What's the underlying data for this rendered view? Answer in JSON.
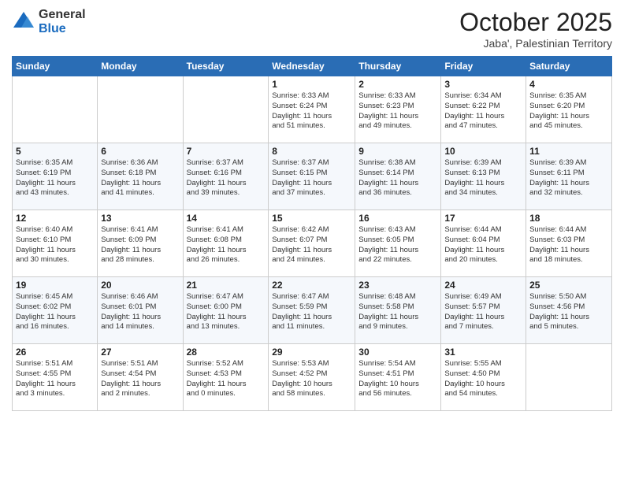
{
  "logo": {
    "general": "General",
    "blue": "Blue"
  },
  "title": "October 2025",
  "location": "Jaba', Palestinian Territory",
  "days_header": [
    "Sunday",
    "Monday",
    "Tuesday",
    "Wednesday",
    "Thursday",
    "Friday",
    "Saturday"
  ],
  "weeks": [
    [
      {
        "num": "",
        "info": ""
      },
      {
        "num": "",
        "info": ""
      },
      {
        "num": "",
        "info": ""
      },
      {
        "num": "1",
        "info": "Sunrise: 6:33 AM\nSunset: 6:24 PM\nDaylight: 11 hours\nand 51 minutes."
      },
      {
        "num": "2",
        "info": "Sunrise: 6:33 AM\nSunset: 6:23 PM\nDaylight: 11 hours\nand 49 minutes."
      },
      {
        "num": "3",
        "info": "Sunrise: 6:34 AM\nSunset: 6:22 PM\nDaylight: 11 hours\nand 47 minutes."
      },
      {
        "num": "4",
        "info": "Sunrise: 6:35 AM\nSunset: 6:20 PM\nDaylight: 11 hours\nand 45 minutes."
      }
    ],
    [
      {
        "num": "5",
        "info": "Sunrise: 6:35 AM\nSunset: 6:19 PM\nDaylight: 11 hours\nand 43 minutes."
      },
      {
        "num": "6",
        "info": "Sunrise: 6:36 AM\nSunset: 6:18 PM\nDaylight: 11 hours\nand 41 minutes."
      },
      {
        "num": "7",
        "info": "Sunrise: 6:37 AM\nSunset: 6:16 PM\nDaylight: 11 hours\nand 39 minutes."
      },
      {
        "num": "8",
        "info": "Sunrise: 6:37 AM\nSunset: 6:15 PM\nDaylight: 11 hours\nand 37 minutes."
      },
      {
        "num": "9",
        "info": "Sunrise: 6:38 AM\nSunset: 6:14 PM\nDaylight: 11 hours\nand 36 minutes."
      },
      {
        "num": "10",
        "info": "Sunrise: 6:39 AM\nSunset: 6:13 PM\nDaylight: 11 hours\nand 34 minutes."
      },
      {
        "num": "11",
        "info": "Sunrise: 6:39 AM\nSunset: 6:11 PM\nDaylight: 11 hours\nand 32 minutes."
      }
    ],
    [
      {
        "num": "12",
        "info": "Sunrise: 6:40 AM\nSunset: 6:10 PM\nDaylight: 11 hours\nand 30 minutes."
      },
      {
        "num": "13",
        "info": "Sunrise: 6:41 AM\nSunset: 6:09 PM\nDaylight: 11 hours\nand 28 minutes."
      },
      {
        "num": "14",
        "info": "Sunrise: 6:41 AM\nSunset: 6:08 PM\nDaylight: 11 hours\nand 26 minutes."
      },
      {
        "num": "15",
        "info": "Sunrise: 6:42 AM\nSunset: 6:07 PM\nDaylight: 11 hours\nand 24 minutes."
      },
      {
        "num": "16",
        "info": "Sunrise: 6:43 AM\nSunset: 6:05 PM\nDaylight: 11 hours\nand 22 minutes."
      },
      {
        "num": "17",
        "info": "Sunrise: 6:44 AM\nSunset: 6:04 PM\nDaylight: 11 hours\nand 20 minutes."
      },
      {
        "num": "18",
        "info": "Sunrise: 6:44 AM\nSunset: 6:03 PM\nDaylight: 11 hours\nand 18 minutes."
      }
    ],
    [
      {
        "num": "19",
        "info": "Sunrise: 6:45 AM\nSunset: 6:02 PM\nDaylight: 11 hours\nand 16 minutes."
      },
      {
        "num": "20",
        "info": "Sunrise: 6:46 AM\nSunset: 6:01 PM\nDaylight: 11 hours\nand 14 minutes."
      },
      {
        "num": "21",
        "info": "Sunrise: 6:47 AM\nSunset: 6:00 PM\nDaylight: 11 hours\nand 13 minutes."
      },
      {
        "num": "22",
        "info": "Sunrise: 6:47 AM\nSunset: 5:59 PM\nDaylight: 11 hours\nand 11 minutes."
      },
      {
        "num": "23",
        "info": "Sunrise: 6:48 AM\nSunset: 5:58 PM\nDaylight: 11 hours\nand 9 minutes."
      },
      {
        "num": "24",
        "info": "Sunrise: 6:49 AM\nSunset: 5:57 PM\nDaylight: 11 hours\nand 7 minutes."
      },
      {
        "num": "25",
        "info": "Sunrise: 5:50 AM\nSunset: 4:56 PM\nDaylight: 11 hours\nand 5 minutes."
      }
    ],
    [
      {
        "num": "26",
        "info": "Sunrise: 5:51 AM\nSunset: 4:55 PM\nDaylight: 11 hours\nand 3 minutes."
      },
      {
        "num": "27",
        "info": "Sunrise: 5:51 AM\nSunset: 4:54 PM\nDaylight: 11 hours\nand 2 minutes."
      },
      {
        "num": "28",
        "info": "Sunrise: 5:52 AM\nSunset: 4:53 PM\nDaylight: 11 hours\nand 0 minutes."
      },
      {
        "num": "29",
        "info": "Sunrise: 5:53 AM\nSunset: 4:52 PM\nDaylight: 10 hours\nand 58 minutes."
      },
      {
        "num": "30",
        "info": "Sunrise: 5:54 AM\nSunset: 4:51 PM\nDaylight: 10 hours\nand 56 minutes."
      },
      {
        "num": "31",
        "info": "Sunrise: 5:55 AM\nSunset: 4:50 PM\nDaylight: 10 hours\nand 54 minutes."
      },
      {
        "num": "",
        "info": ""
      }
    ]
  ]
}
